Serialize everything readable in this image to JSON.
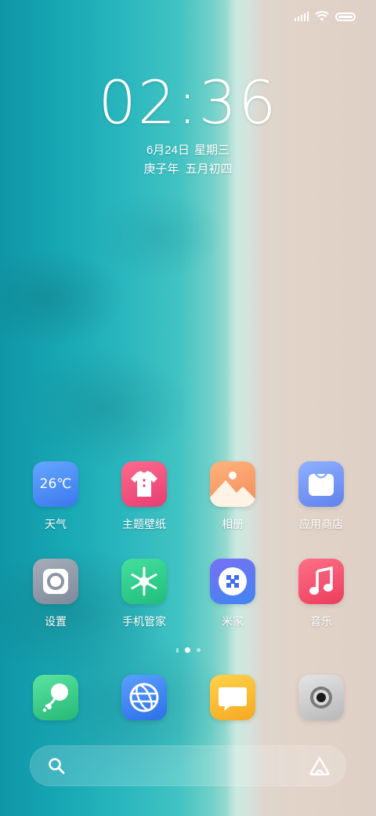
{
  "status_bar": {
    "signal_icon": "signal-bars-icon",
    "wifi_icon": "wifi-icon",
    "battery_icon": "battery-icon",
    "battery_level": 1.0
  },
  "lock_clock": {
    "time": "02:36",
    "date": "6月24日",
    "weekday": "星期三",
    "lunar_year": "庚子年",
    "lunar_date": "五月初四"
  },
  "apps_row1": [
    {
      "label": "天气",
      "icon": "weather-icon",
      "icon_text": "26℃",
      "color": "#4f8ff7"
    },
    {
      "label": "主题壁纸",
      "icon": "theme-shirt-icon",
      "color": "#ef4d7c"
    },
    {
      "label": "相册",
      "icon": "gallery-icon",
      "color": "#f6a66e"
    },
    {
      "label": "应用商店",
      "icon": "app-store-bag-icon",
      "color": "#6f93f0"
    }
  ],
  "apps_row2": [
    {
      "label": "设置",
      "icon": "settings-icon",
      "color": "#8b96a6"
    },
    {
      "label": "手机管家",
      "icon": "security-snowflake-icon",
      "color": "#2fcf8c"
    },
    {
      "label": "米家",
      "icon": "mi-home-icon",
      "color": "#5a74f0"
    },
    {
      "label": "音乐",
      "icon": "music-note-icon",
      "color": "#f2566f"
    }
  ],
  "dock": [
    {
      "icon": "phone-dialer-icon",
      "color": "#3fcf8a"
    },
    {
      "icon": "browser-globe-icon",
      "color": "#3d82f2"
    },
    {
      "icon": "messages-icon",
      "color": "#fbbf33"
    },
    {
      "icon": "camera-icon",
      "color": "#c9c9c9"
    }
  ],
  "page_indicator": {
    "pages": 2,
    "active": 1
  },
  "search_bar": {
    "search_icon": "search-icon",
    "assistant_icon": "assistant-icon"
  }
}
